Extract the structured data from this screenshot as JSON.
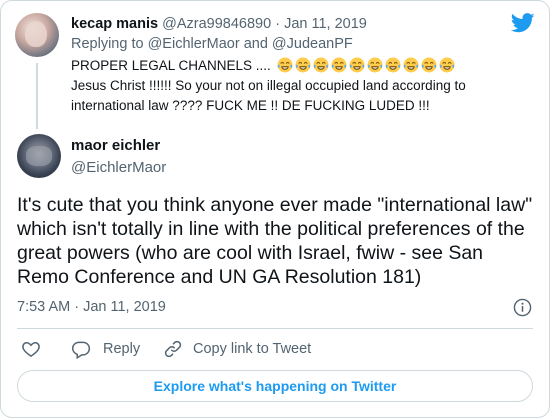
{
  "parent_tweet": {
    "author_name": "kecap manis",
    "handle": "@Azra99846890",
    "separator": "·",
    "date": "Jan 11, 2019",
    "replying_label": "Replying to",
    "mention_1": "@EichlerMaor",
    "and_label": "and",
    "mention_2": "@JudeanPF",
    "text_line_1": "PROPER LEGAL CHANNELS ....",
    "emoji_name": "face-with-tears-of-joy-icon",
    "emoji_count": 10,
    "text_line_2": "Jesus Christ !!!!!! So your not on illegal occupied land according to international law ???? FUCK ME !! DE FUCKING LUDED !!!"
  },
  "tweet": {
    "author_name": "maor eichler",
    "handle": "@EichlerMaor",
    "text": "It's cute that you think anyone ever made \"international law\" which isn't totally in line with the political preferences of the great powers (who are cool with Israel, fwiw - see San Remo Conference and UN GA Resolution 181)",
    "timestamp": "7:53 AM · Jan 11, 2019"
  },
  "actions": {
    "like_icon": "heart-icon",
    "reply_label": "Reply",
    "copy_label": "Copy link to Tweet"
  },
  "explore_label": "Explore what's happening on Twitter",
  "colors": {
    "accent": "#1d9bf0",
    "text_primary": "#0f1419",
    "text_secondary": "#536471",
    "border": "#cfd9de"
  }
}
